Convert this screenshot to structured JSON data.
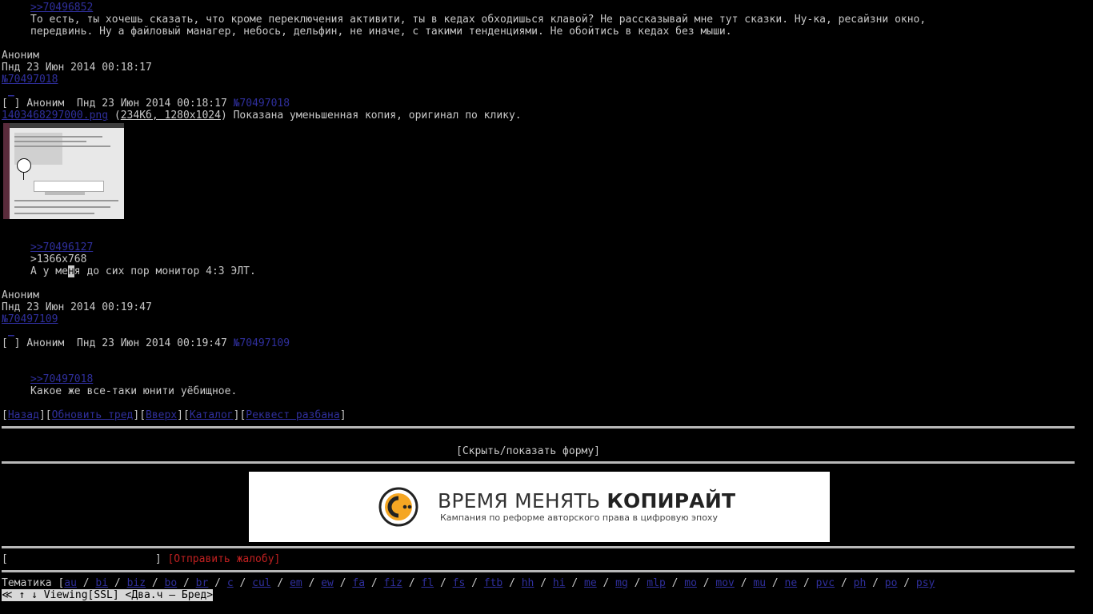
{
  "post1": {
    "reply_link": ">>70496852",
    "text_line1": "То есть, ты хочешь сказать, что кроме переключения активити, ты в кедах обходишься клавой? Не рассказывай мне тут сказки. Ну-ка, ресайзни окно,",
    "text_line2": "передвинь. Ну а файловый манагер, небось, дельфин, не иначе, с такими тенденциями. Не обойтись в кедах без мыши."
  },
  "post2": {
    "author": "Аноним",
    "date": "Пнд 23 Июн 2014 00:18:17",
    "number": "№70497018",
    "header_checkbox": "[ ]",
    "header_author": "Аноним",
    "header_date": "Пнд 23 Июн 2014 00:18:17",
    "header_number": "№70497018",
    "file_name": "1403468297000.png",
    "file_info": "234Кб, 1280x1024",
    "file_note": "Показана уменьшенная копия, оригинал по клику.",
    "reply_link": ">>70496127",
    "quote": ">1366x768",
    "text_before_cursor": "А у ме",
    "cursor_char": "н",
    "text_after_cursor": "я до сих пор монитор 4:3 ЭЛТ."
  },
  "post3": {
    "author": "Аноним",
    "date": "Пнд 23 Июн 2014 00:19:47",
    "number": "№70497109",
    "header_checkbox": "[ ]",
    "header_author": "Аноним",
    "header_date": "Пнд 23 Июн 2014 00:19:47",
    "header_number": "№70497109",
    "reply_link": ">>70497018",
    "text": "Какое же все-таки юнити уёбищное."
  },
  "nav": {
    "back": "Назад",
    "refresh": "Обновить тред",
    "up": "Вверх",
    "catalog": "Каталог",
    "unban": "Реквест разбана"
  },
  "toggle_form": "[Скрыть/показать форму]",
  "banner": {
    "title_regular": "ВРЕМЯ МЕНЯТЬ ",
    "title_bold": "КОПИРАЙТ",
    "subtitle": "Кампания по реформе авторского права в цифровую эпоху",
    "accent_color": "#f5a623"
  },
  "report": {
    "field_value": "",
    "button_label": "[Отправить жалобу]"
  },
  "boards": {
    "label": "Тематика [",
    "items": [
      "au",
      "bi",
      "biz",
      "bo",
      "br",
      "c",
      "cul",
      "em",
      "ew",
      "fa",
      "fiz",
      "fl",
      "fs",
      "ftb",
      "hh",
      "hi",
      "me",
      "mg",
      "mlp",
      "mo",
      "mov",
      "mu",
      "ne",
      "pvc",
      "ph",
      "po",
      "psy"
    ]
  },
  "status": {
    "text": "↑ ↓ Viewing[SSL] <Два.ч — Бред>",
    "left_icon": "back-arrow-icon"
  }
}
